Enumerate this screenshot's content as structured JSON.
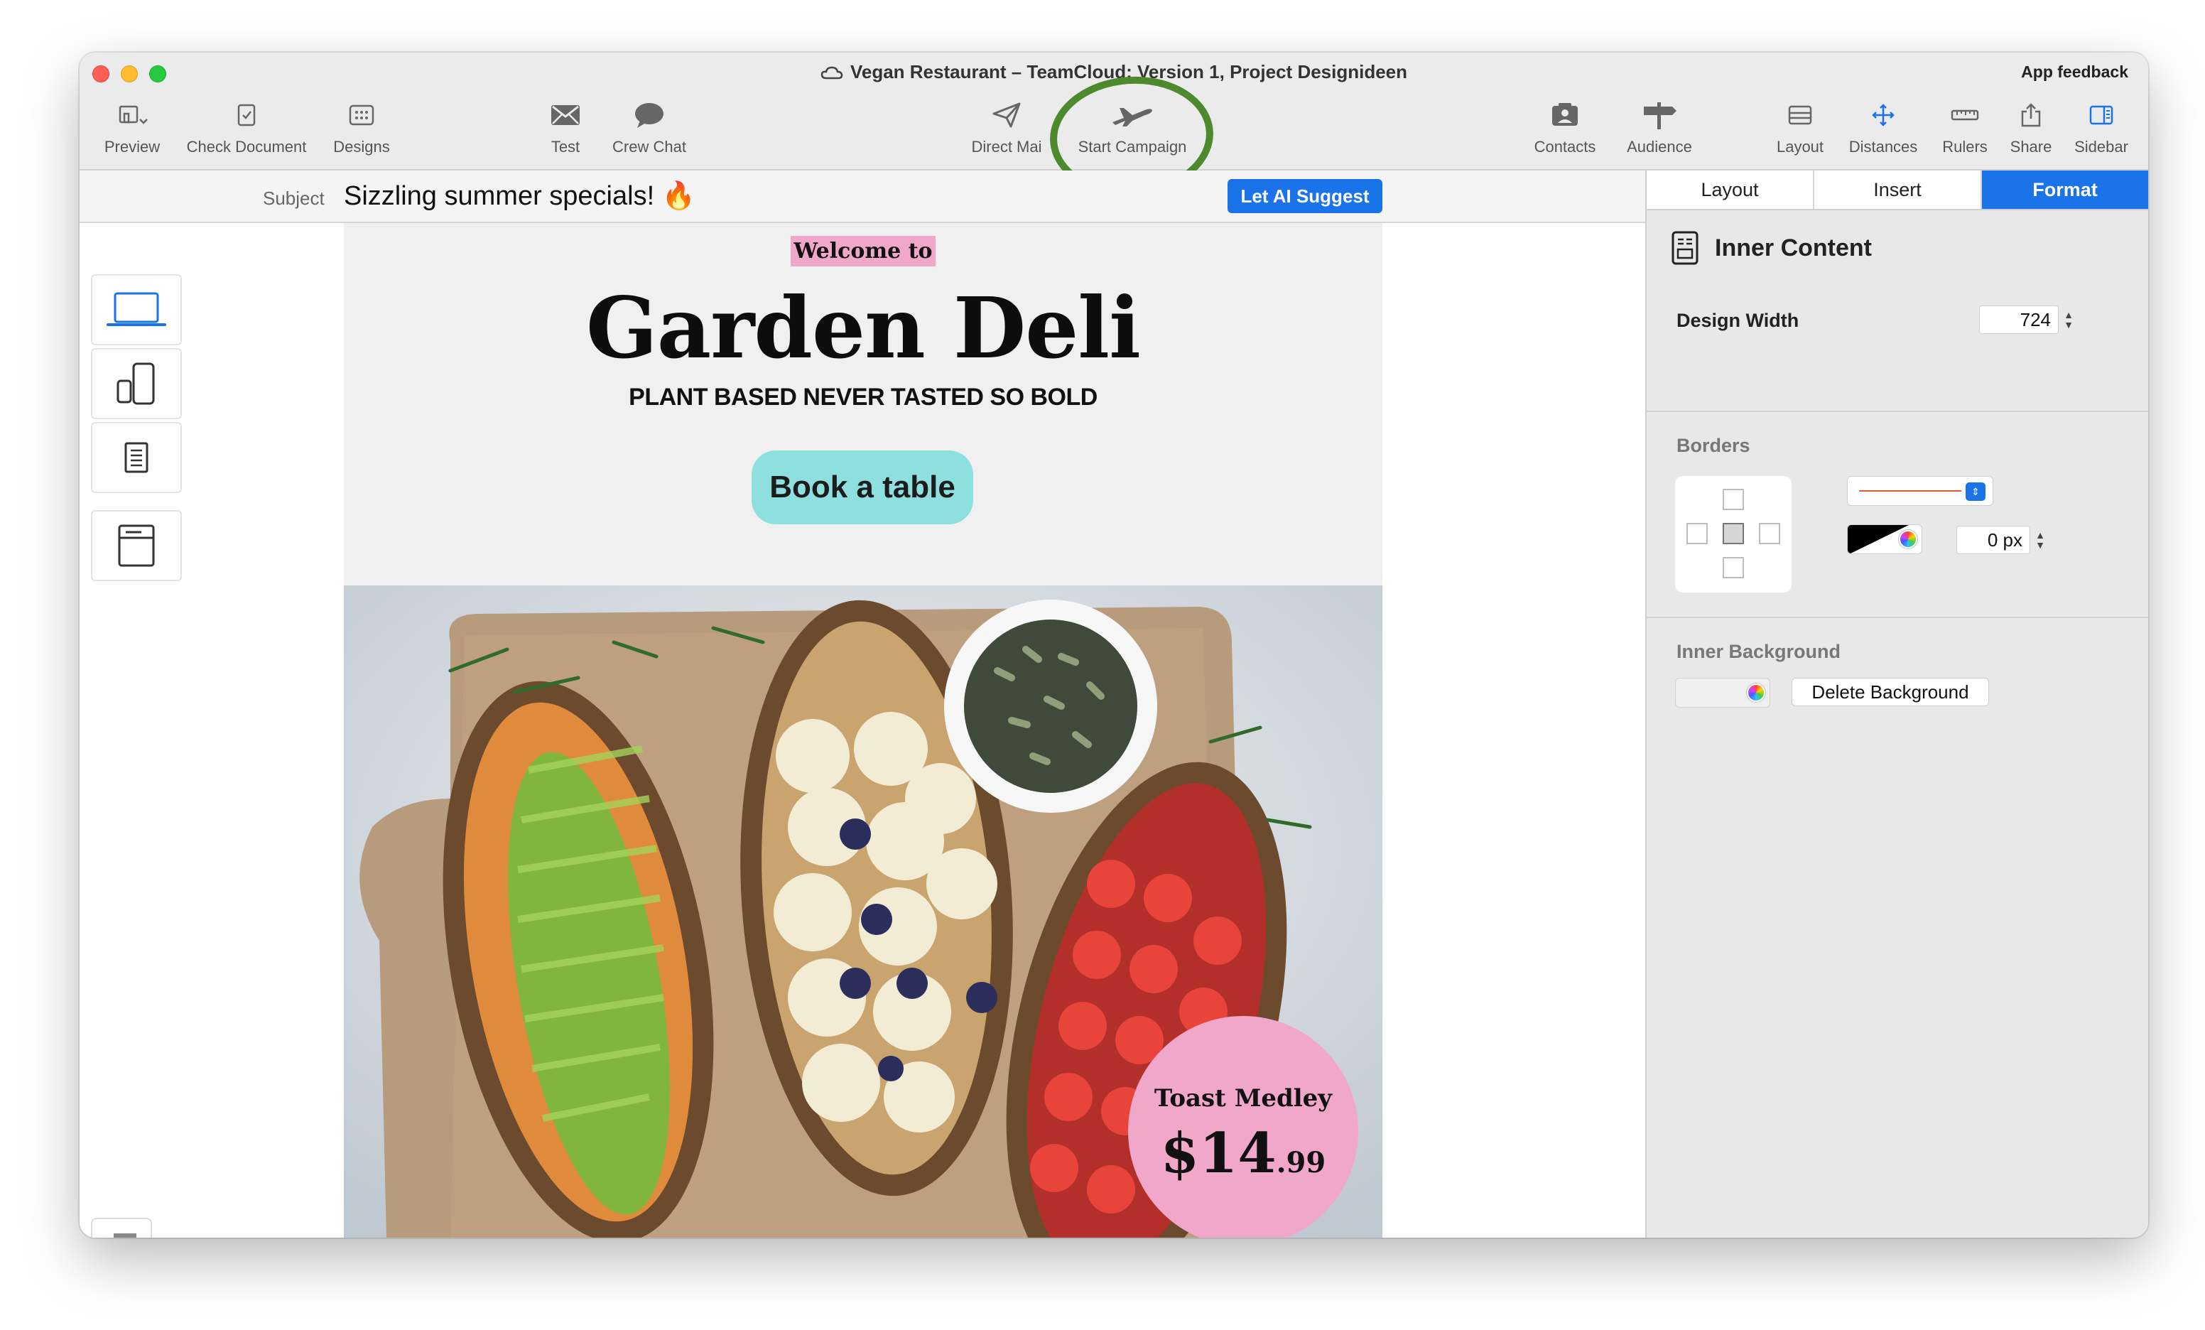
{
  "window": {
    "title": "Vegan Restaurant – TeamCloud: Version 1, Project  Designideen",
    "feedback_label": "App feedback"
  },
  "toolbar": {
    "preview": "Preview",
    "check_document": "Check Document",
    "designs": "Designs",
    "test": "Test",
    "crew_chat": "Crew Chat",
    "direct_mail": "Direct Mai",
    "start_campaign": "Start Campaign",
    "contacts": "Contacts",
    "audience": "Audience",
    "layout": "Layout",
    "distances": "Distances",
    "rulers": "Rulers",
    "share": "Share",
    "sidebar": "Sidebar"
  },
  "subject": {
    "label": "Subject",
    "value": "Sizzling summer specials! 🔥",
    "ai_button": "Let AI Suggest"
  },
  "email": {
    "welcome": "Welcome to",
    "brand": "Garden Deli",
    "tagline": "PLANT BASED NEVER TASTED SO BOLD",
    "cta": "Book a table",
    "badge_name": "Toast Medley",
    "badge_price_main": "$14",
    "badge_price_cents": ".99"
  },
  "sidebar": {
    "tabs": [
      "Layout",
      "Insert",
      "Format"
    ],
    "active_tab": "Format",
    "section_title": "Inner Content",
    "design_width_label": "Design Width",
    "design_width_value": "724",
    "borders_label": "Borders",
    "border_width_value": "0 px",
    "inner_background_label": "Inner Background",
    "delete_background": "Delete Background"
  },
  "colors": {
    "accent": "#1a73e8",
    "badge_pink": "#f0a7c9",
    "cta_teal": "#8ee0df",
    "highlight_ring": "#4d8a2e"
  }
}
